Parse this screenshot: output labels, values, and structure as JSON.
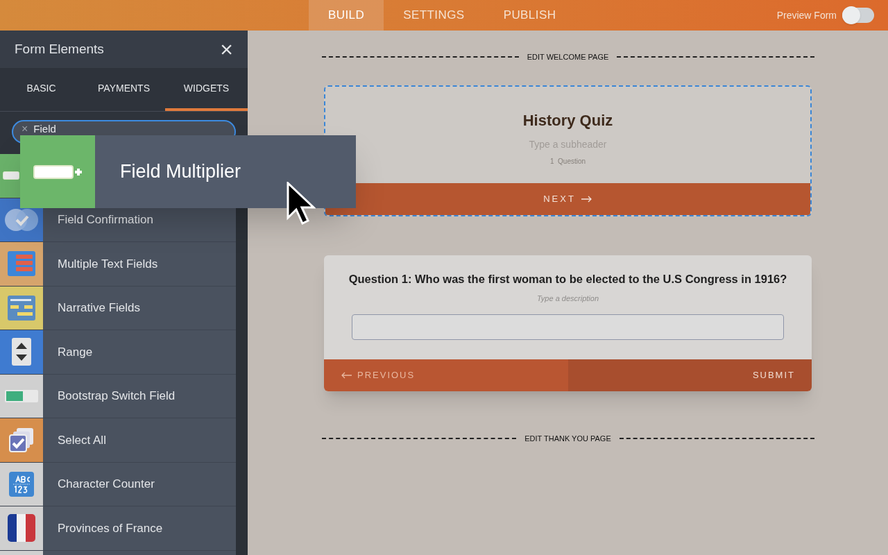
{
  "top_bar": {
    "tabs": [
      {
        "label": "BUILD",
        "selected": true
      },
      {
        "label": "SETTINGS",
        "selected": false
      },
      {
        "label": "PUBLISH",
        "selected": false
      }
    ],
    "preview": {
      "label": "Preview Form",
      "on": false
    }
  },
  "sidebar": {
    "title": "Form Elements",
    "close": "×",
    "tabs": [
      {
        "label": "BASIC",
        "selected": false
      },
      {
        "label": "PAYMENTS",
        "selected": false
      },
      {
        "label": "WIDGETS",
        "selected": true
      }
    ],
    "search": {
      "clear": "×",
      "value": "Field"
    },
    "items": [
      {
        "kind": "multiplier"
      },
      {
        "kind": "confirmation",
        "label": "Field Confirmation"
      },
      {
        "kind": "multitext",
        "label": "Multiple Text Fields"
      },
      {
        "kind": "narrative",
        "label": "Narrative Fields"
      },
      {
        "kind": "range",
        "label": "Range"
      },
      {
        "kind": "switch",
        "label": "Bootstrap Switch Field"
      },
      {
        "kind": "selectall",
        "label": "Select All"
      },
      {
        "kind": "counter",
        "label": "Character Counter"
      },
      {
        "kind": "flag",
        "label": "Provinces of France"
      },
      {
        "kind": "blank"
      }
    ]
  },
  "drag_item": {
    "label": "Field Multiplier"
  },
  "canvas": {
    "welcome_divider": "EDIT WELCOME PAGE",
    "welcome_card": {
      "selected": true,
      "title": "History Quiz",
      "subheader_placeholder": "Type a subheader",
      "count": "1  Question",
      "next": "NEXT"
    },
    "question_card": {
      "question": "Question 1: Who was the first woman to be elected to the U.S Congress in 1916?",
      "description_placeholder": "Type a description",
      "previous": "PREVIOUS",
      "submit": "SUBMIT"
    },
    "thanks_divider": "EDIT THANK YOU PAGE"
  }
}
